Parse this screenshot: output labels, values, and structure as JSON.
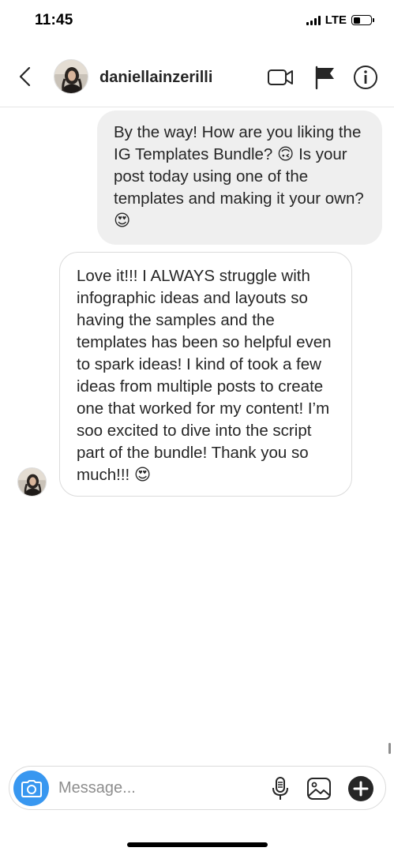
{
  "status_bar": {
    "time": "11:45",
    "network": "LTE"
  },
  "header": {
    "username": "daniellainzerilli",
    "icons": [
      "back-icon",
      "video-call-icon",
      "flag-icon",
      "info-icon"
    ]
  },
  "messages": [
    {
      "direction": "outgoing",
      "text": "By the way! How are you liking the IG Templates Bundle? 🙃 Is your post today using one of the templates and making it your own? 😍"
    },
    {
      "direction": "incoming",
      "text": "Love it!!! I ALWAYS struggle with infographic ideas and layouts so having the samples and the templates has been so helpful even to spark ideas! I kind of took a few ideas from multiple posts to create one that worked for my content! I’m soo excited to dive into the script part of the bundle! Thank you so much!!! 😍"
    }
  ],
  "composer": {
    "placeholder": "Message...",
    "icons": [
      "camera-icon",
      "microphone-icon",
      "gallery-icon",
      "plus-icon"
    ]
  },
  "colors": {
    "accent_blue": "#3897f0",
    "outgoing_bubble": "#efefef",
    "incoming_border": "#dbdbdb",
    "text": "#262626",
    "placeholder": "#8e8e8e"
  }
}
